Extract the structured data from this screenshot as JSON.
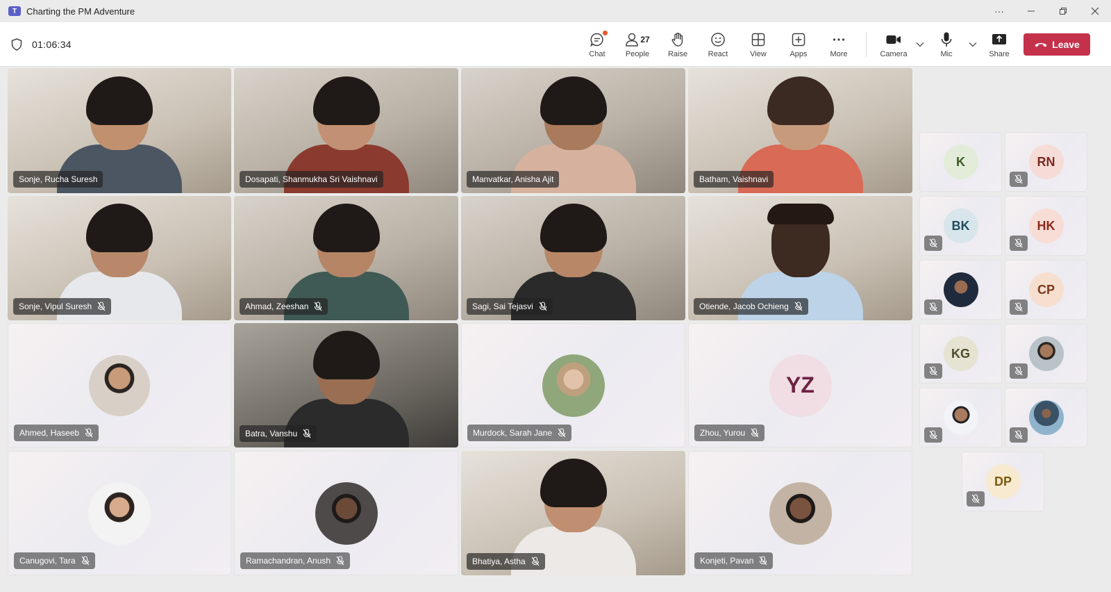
{
  "window": {
    "title": "Charting the PM Adventure",
    "app_logo": "T",
    "more_glyph": "···"
  },
  "meeting": {
    "elapsed": "01:06:34"
  },
  "toolbar": {
    "chat": "Chat",
    "people": "People",
    "people_count": "27",
    "raise": "Raise",
    "react": "React",
    "view": "View",
    "apps": "Apps",
    "more": "More",
    "camera": "Camera",
    "mic": "Mic",
    "share": "Share",
    "leave": "Leave"
  },
  "colors": {
    "accent": "#5b5fc7",
    "leave": "#c4314b",
    "chat_badge": "#e8592d"
  },
  "tiles": [
    {
      "name": "Sonje, Rucha Suresh",
      "kind": "video",
      "muted": false
    },
    {
      "name": "Dosapati, Shanmukha Sri Vaishnavi",
      "kind": "video",
      "muted": false
    },
    {
      "name": "Manvatkar, Anisha Ajit",
      "kind": "video",
      "muted": false
    },
    {
      "name": "Batham, Vaishnavi",
      "kind": "video",
      "muted": false
    },
    {
      "name": "Sonje, Vipul Suresh",
      "kind": "video",
      "muted": true
    },
    {
      "name": "Ahmad, Zeeshan",
      "kind": "video",
      "muted": true
    },
    {
      "name": "Sagi, Sai Tejasvi",
      "kind": "video",
      "muted": true
    },
    {
      "name": "Otiende, Jacob Ochieng",
      "kind": "video",
      "muted": true
    },
    {
      "name": "Ahmed, Haseeb",
      "kind": "photo",
      "muted": true
    },
    {
      "name": "Batra, Vanshu",
      "kind": "video",
      "muted": true
    },
    {
      "name": "Murdock, Sarah Jane",
      "kind": "photo",
      "muted": true
    },
    {
      "name": "Zhou, Yurou",
      "kind": "initials",
      "initials": "YZ",
      "muted": true
    },
    {
      "name": "Canugovi, Tara",
      "kind": "photo",
      "muted": true
    },
    {
      "name": "Ramachandran, Anush",
      "kind": "photo",
      "muted": true
    },
    {
      "name": "Bhatiya, Astha",
      "kind": "video",
      "muted": true
    },
    {
      "name": "Konjeti, Pavan",
      "kind": "photo",
      "muted": true
    }
  ],
  "overflow": [
    {
      "initials": "K",
      "muted": false
    },
    {
      "initials": "RN",
      "muted": true
    },
    {
      "initials": "BK",
      "muted": true
    },
    {
      "initials": "HK",
      "muted": true
    },
    {
      "initials": "",
      "muted": true
    },
    {
      "initials": "CP",
      "muted": true
    },
    {
      "initials": "KG",
      "muted": true
    },
    {
      "initials": "",
      "muted": true
    },
    {
      "initials": "",
      "muted": true
    },
    {
      "initials": "",
      "muted": true
    },
    {
      "initials": "DP",
      "muted": true
    }
  ]
}
